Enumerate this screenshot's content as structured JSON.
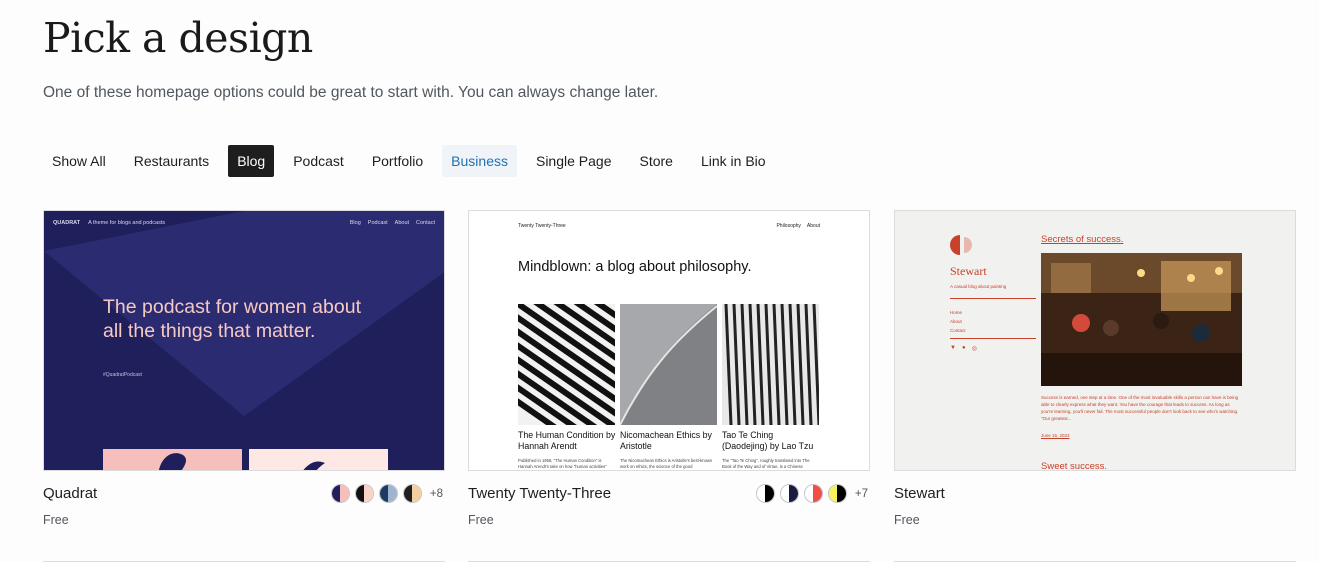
{
  "header": {
    "title": "Pick a design",
    "subtitle": "One of these homepage options could be great to start with. You can always change later."
  },
  "tabs": [
    {
      "label": "Show All",
      "state": "default"
    },
    {
      "label": "Restaurants",
      "state": "default"
    },
    {
      "label": "Blog",
      "state": "active"
    },
    {
      "label": "Podcast",
      "state": "default"
    },
    {
      "label": "Portfolio",
      "state": "default"
    },
    {
      "label": "Business",
      "state": "hover"
    },
    {
      "label": "Single Page",
      "state": "default"
    },
    {
      "label": "Store",
      "state": "default"
    },
    {
      "label": "Link in Bio",
      "state": "default"
    }
  ],
  "cards": [
    {
      "name": "Quadrat",
      "price": "Free",
      "more_variations": "+8",
      "swatches": [
        [
          "#1f1f5c",
          "#f7bfbb"
        ],
        [
          "#111111",
          "#fbd3c4"
        ],
        [
          "#1d3a63",
          "#9fb4cf"
        ],
        [
          "#1f1f1f",
          "#f5cfa0"
        ]
      ],
      "preview": {
        "brand": "QUADRAT",
        "tagline": "A theme for blogs and podcasts",
        "nav": [
          "Blog",
          "Podcast",
          "About",
          "Contact"
        ],
        "headline": "The podcast for women about all the things that matter.",
        "hashtag": "#QuadratPodcast"
      }
    },
    {
      "name": "Twenty Twenty-Three",
      "price": "Free",
      "more_variations": "+7",
      "swatches": [
        [
          "#ffffff",
          "#000000"
        ],
        [
          "#ffffff",
          "#1a1a3e"
        ],
        [
          "#ffffff",
          "#ef4f45"
        ],
        [
          "#f6f15e",
          "#000000"
        ]
      ],
      "preview": {
        "site": "Twenty Twenty-Three",
        "nav": [
          "Philosophy",
          "About"
        ],
        "headline": "Mindblown: a blog about philosophy.",
        "posts": [
          {
            "title": "The Human Condition by Hannah Arendt",
            "excerpt": "Published in 1958, \"The Human Condition\" is Hannah Arendt's take on how \"human activities\""
          },
          {
            "title": "Nicomachean Ethics by Aristotle",
            "excerpt": "The Nicomachean Ethics is Aristotle's best-known work on ethics, the science of the good"
          },
          {
            "title": "Tao Te Ching (Daodejing) by Lao Tzu",
            "excerpt": "The \"Tao Te Ching\", roughly translated into The Book of the Way and of Virtue, is a Chinese"
          }
        ]
      }
    },
    {
      "name": "Stewart",
      "price": "Free",
      "preview": {
        "site": "Stewart",
        "tagline": "A casual blog about painting",
        "menu": [
          "Home",
          "About",
          "Contact"
        ],
        "post_title": "Secrets of success.",
        "paragraph": "Success is earned, one step at a time. One of the most invaluable skills a person can have is being able to clearly express what they want. You have the courage that leads to success. As long as you're learning, you'll never fail. The most successful people don't look back to see who's watching. \"Our greatest...",
        "date": "June 15, 2023",
        "second_title": "Sweet success."
      }
    }
  ],
  "colors": {
    "accent": "#2271b1",
    "active_tab": "#1e1e1e",
    "stewart": "#c9412b",
    "quadrat_bg": "#1f1f5c"
  }
}
